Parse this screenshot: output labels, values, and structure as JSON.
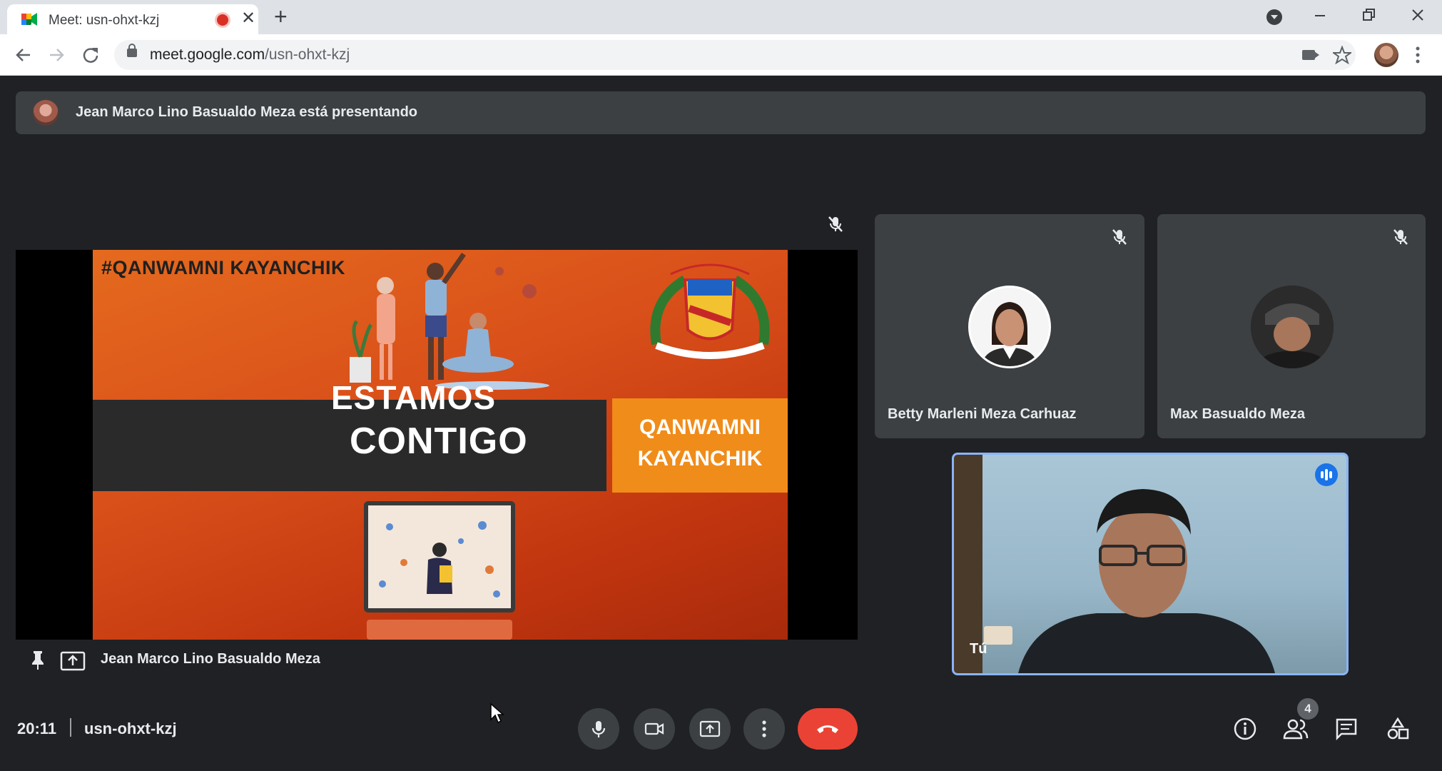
{
  "browser": {
    "tab_title": "Meet: usn-ohxt-kzj",
    "new_tab_symbol": "+",
    "tab_close_symbol": "✕",
    "url_host": "meet.google.com",
    "url_path": "/usn-ohxt-kzj"
  },
  "presenting_banner": {
    "text": "Jean Marco Lino Basualdo Meza está presentando"
  },
  "main_tile": {
    "presenter_name": "Jean Marco Lino Basualdo Meza",
    "slide": {
      "hashtag": "#QANWAMNI KAYANCHIK",
      "title_line1": "ESTAMOS",
      "title_line2": "CONTIGO",
      "box_line1": "QANWAMNI",
      "box_line2": "KAYANCHIK"
    }
  },
  "participants": [
    {
      "name": "Betty Marleni Meza Carhuaz"
    },
    {
      "name": "Max Basualdo Meza"
    }
  ],
  "self_tile": {
    "label": "Tú"
  },
  "bottom_bar": {
    "time": "20:11",
    "meeting_code": "usn-ohxt-kzj",
    "participant_count": "4"
  },
  "colors": {
    "meet_background": "#202124",
    "tile_background": "#3c4043",
    "hangup_red": "#ea4335",
    "self_border": "#8ab4f8",
    "speaking_blue": "#1a73e8",
    "slide_orange": "#e56a1e"
  }
}
